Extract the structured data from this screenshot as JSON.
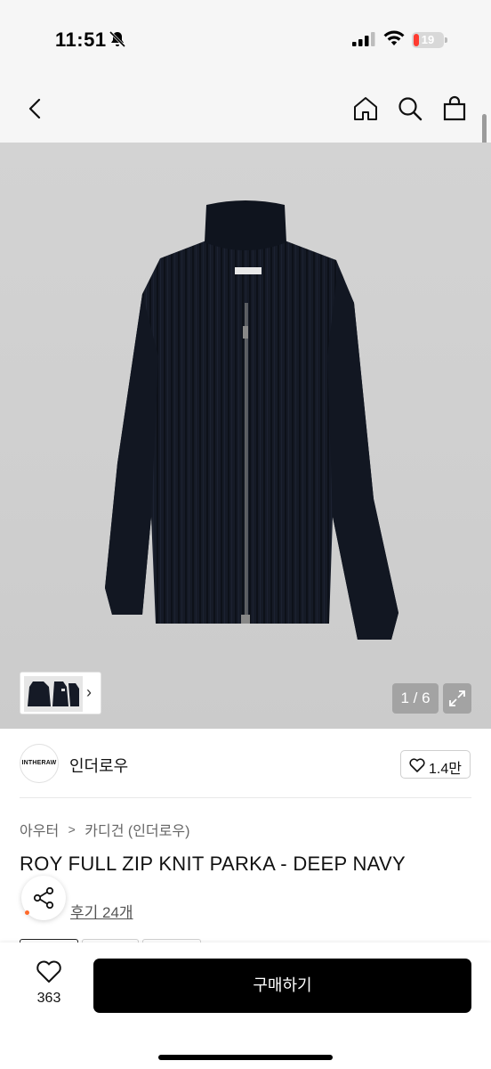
{
  "status_bar": {
    "time": "11:51",
    "battery_level": "19",
    "battery_fraction": 0.19,
    "icons": [
      "bell-slash-icon",
      "cellular-signal-icon",
      "wifi-icon",
      "battery-icon"
    ]
  },
  "nav": {
    "icons": [
      "chevron-left-icon",
      "home-icon",
      "search-icon",
      "shopping-bag-icon"
    ]
  },
  "gallery": {
    "counter": "1 / 6",
    "current_image": 1,
    "total_images": 6,
    "garment_color": "#151a26",
    "icons": [
      "chevron-right-icon",
      "expand-icon"
    ]
  },
  "brand": {
    "logo_text": "INTHERAW",
    "name": "인더로우",
    "like_count": "1.4만"
  },
  "breadcrumb": {
    "category": "아우터",
    "subcategory": "카디건 (인더로우)",
    "separator": ">"
  },
  "product": {
    "title": "ROY FULL ZIP KNIT PARKA - DEEP NAVY",
    "review_link": "후기 24개"
  },
  "bottom_bar": {
    "wishlist_count": "363",
    "buy_label": "구매하기"
  },
  "colors": {
    "accent": "#000000",
    "battery": "#ff3b30",
    "review_dot": "#ff6a2b"
  }
}
